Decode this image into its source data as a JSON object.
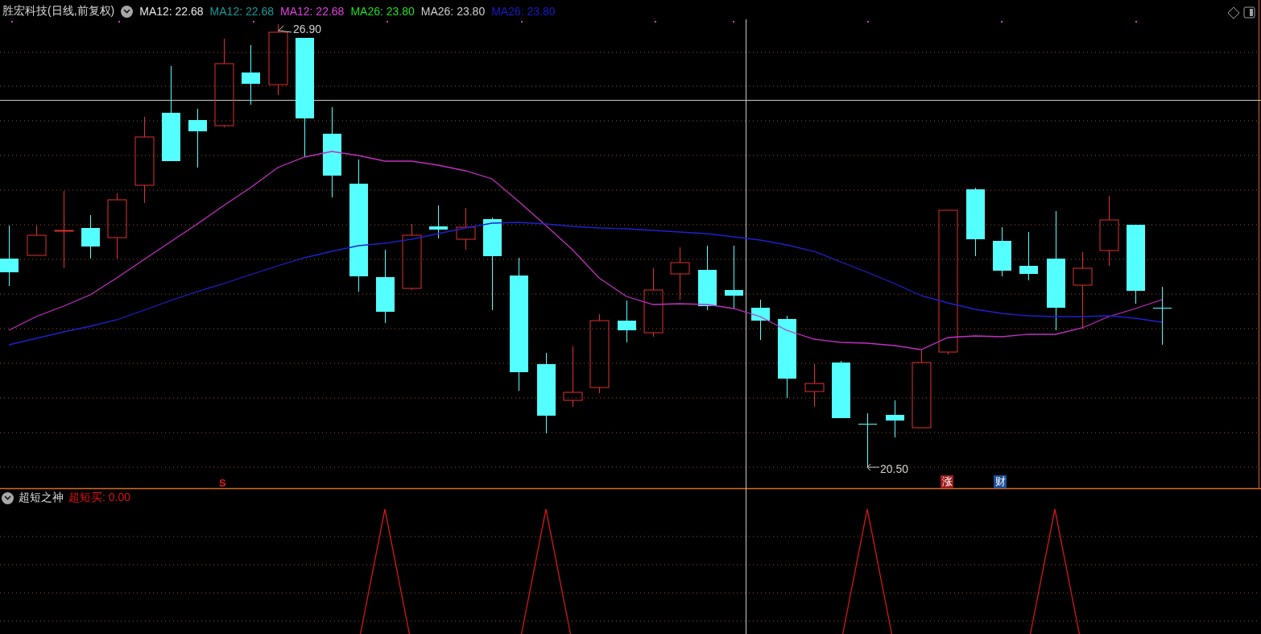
{
  "main_panel": {
    "title": "胜宏科技(日线,前复权)",
    "indicators": [
      {
        "label": "MA12: 22.68",
        "color": "#e8e8e8"
      },
      {
        "label": "MA12: 22.68",
        "color": "#1a9a9a"
      },
      {
        "label": "MA12: 22.68",
        "color": "#e040e0"
      },
      {
        "label": "MA26: 23.80",
        "color": "#22dd22"
      },
      {
        "label": "MA26: 23.80",
        "color": "#cfcfcf"
      },
      {
        "label": "MA26: 23.80",
        "color": "#1a1acc"
      }
    ],
    "high_label": "26.90",
    "low_label": "20.50",
    "signals": [
      {
        "kind": "buy",
        "text": "S"
      }
    ],
    "badges": [
      {
        "text": "涨",
        "color": "#a01c1c"
      },
      {
        "text": "财",
        "color": "#1d4f96"
      }
    ]
  },
  "sub_panel": {
    "title": "超短之神",
    "indicator": {
      "label": "超短买: 0.00",
      "color": "#e01010"
    }
  }
}
